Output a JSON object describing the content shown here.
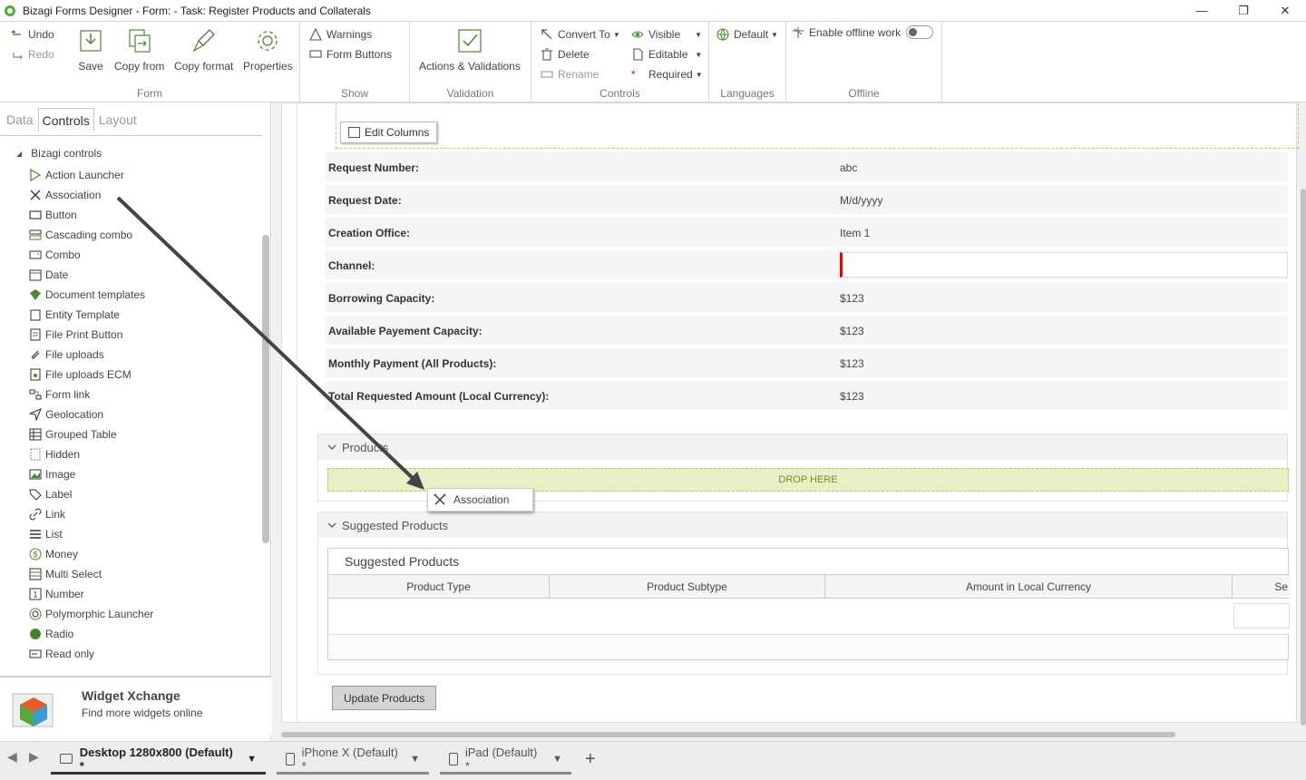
{
  "window": {
    "title": "Bizagi Forms Designer  - Form:  - Task:  Register Products and Collaterals",
    "minimize": "—",
    "maximize": "❐",
    "close": "✕"
  },
  "ribbon": {
    "undo": "Undo",
    "redo": "Redo",
    "save": "Save",
    "copy_from": "Copy from",
    "copy_format": "Copy format",
    "properties": "Properties",
    "form_group": "Form",
    "warnings": "Warnings",
    "form_buttons": "Form Buttons",
    "show_group": "Show",
    "actions_validations": "Actions & Validations",
    "validation_group": "Validation",
    "convert_to": "Convert To",
    "delete": "Delete",
    "rename": "Rename",
    "visible": "Visible",
    "editable": "Editable",
    "required": "Required",
    "controls_group": "Controls",
    "default_lang": "Default",
    "languages_group": "Languages",
    "enable_offline": "Enable offline work",
    "offline_group": "Offline"
  },
  "left_panel": {
    "tabs": [
      "Data",
      "Controls",
      "Layout"
    ],
    "active_tab": "Controls",
    "root": "Bizagi controls",
    "items": [
      {
        "label": "Action Launcher",
        "icon": "play-outline-icon"
      },
      {
        "label": "Association",
        "icon": "association-icon"
      },
      {
        "label": "Button",
        "icon": "button-icon"
      },
      {
        "label": "Cascading combo",
        "icon": "cascading-combo-icon"
      },
      {
        "label": "Combo",
        "icon": "combo-icon"
      },
      {
        "label": "Date",
        "icon": "calendar-icon"
      },
      {
        "label": "Document templates",
        "icon": "document-template-icon"
      },
      {
        "label": "Entity Template",
        "icon": "entity-template-icon"
      },
      {
        "label": "File Print Button",
        "icon": "file-print-icon"
      },
      {
        "label": "File uploads",
        "icon": "paperclip-icon"
      },
      {
        "label": "File uploads ECM",
        "icon": "file-ecm-icon"
      },
      {
        "label": "Form link",
        "icon": "form-link-icon"
      },
      {
        "label": "Geolocation",
        "icon": "geolocation-icon"
      },
      {
        "label": "Grouped Table",
        "icon": "grouped-table-icon"
      },
      {
        "label": "Hidden",
        "icon": "hidden-icon"
      },
      {
        "label": "Image",
        "icon": "image-icon"
      },
      {
        "label": "Label",
        "icon": "label-tag-icon"
      },
      {
        "label": "Link",
        "icon": "link-icon"
      },
      {
        "label": "List",
        "icon": "list-icon"
      },
      {
        "label": "Money",
        "icon": "money-icon"
      },
      {
        "label": "Multi Select",
        "icon": "multi-select-icon"
      },
      {
        "label": "Number",
        "icon": "number-icon"
      },
      {
        "label": "Polymorphic Launcher",
        "icon": "polymorphic-icon"
      },
      {
        "label": "Radio",
        "icon": "radio-icon"
      },
      {
        "label": "Read only",
        "icon": "read-only-icon"
      }
    ],
    "widget": {
      "title": "Widget Xchange",
      "subtitle": "Find more widgets online"
    }
  },
  "form": {
    "edit_columns": "Edit Columns",
    "fields": [
      {
        "label": "Request Number:",
        "value": "abc"
      },
      {
        "label": "Request Date:",
        "value": "M/d/yyyy"
      },
      {
        "label": "Creation Office:",
        "value": "Item 1"
      },
      {
        "label": "Channel:",
        "value": ""
      },
      {
        "label": "Borrowing Capacity:",
        "value": "$123"
      },
      {
        "label": "Available Payement Capacity:",
        "value": "$123"
      },
      {
        "label": "Monthly Payment (All Products):",
        "value": "$123"
      },
      {
        "label": "Total Requested Amount (Local Currency):",
        "value": "$123"
      }
    ],
    "products_section": "Products",
    "drop_here": "DROP HERE",
    "drag_ghost": "Association",
    "suggested_section": "Suggested Products",
    "suggested_table_title": "Suggested Products",
    "columns": [
      "Product Type",
      "Product Subtype",
      "Amount in Local Currency",
      "Se"
    ],
    "update_button": "Update Products"
  },
  "bottom_tabs": [
    {
      "label": "Desktop 1280x800 (Default) *",
      "active": true
    },
    {
      "label": "iPhone X (Default) *",
      "active": false
    },
    {
      "label": "iPad (Default) *",
      "active": false
    }
  ],
  "add_tab": "+",
  "colors": {
    "accent_green": "#55a83a",
    "drop_zone": "#e6f0c4",
    "required_red": "#e00000"
  }
}
